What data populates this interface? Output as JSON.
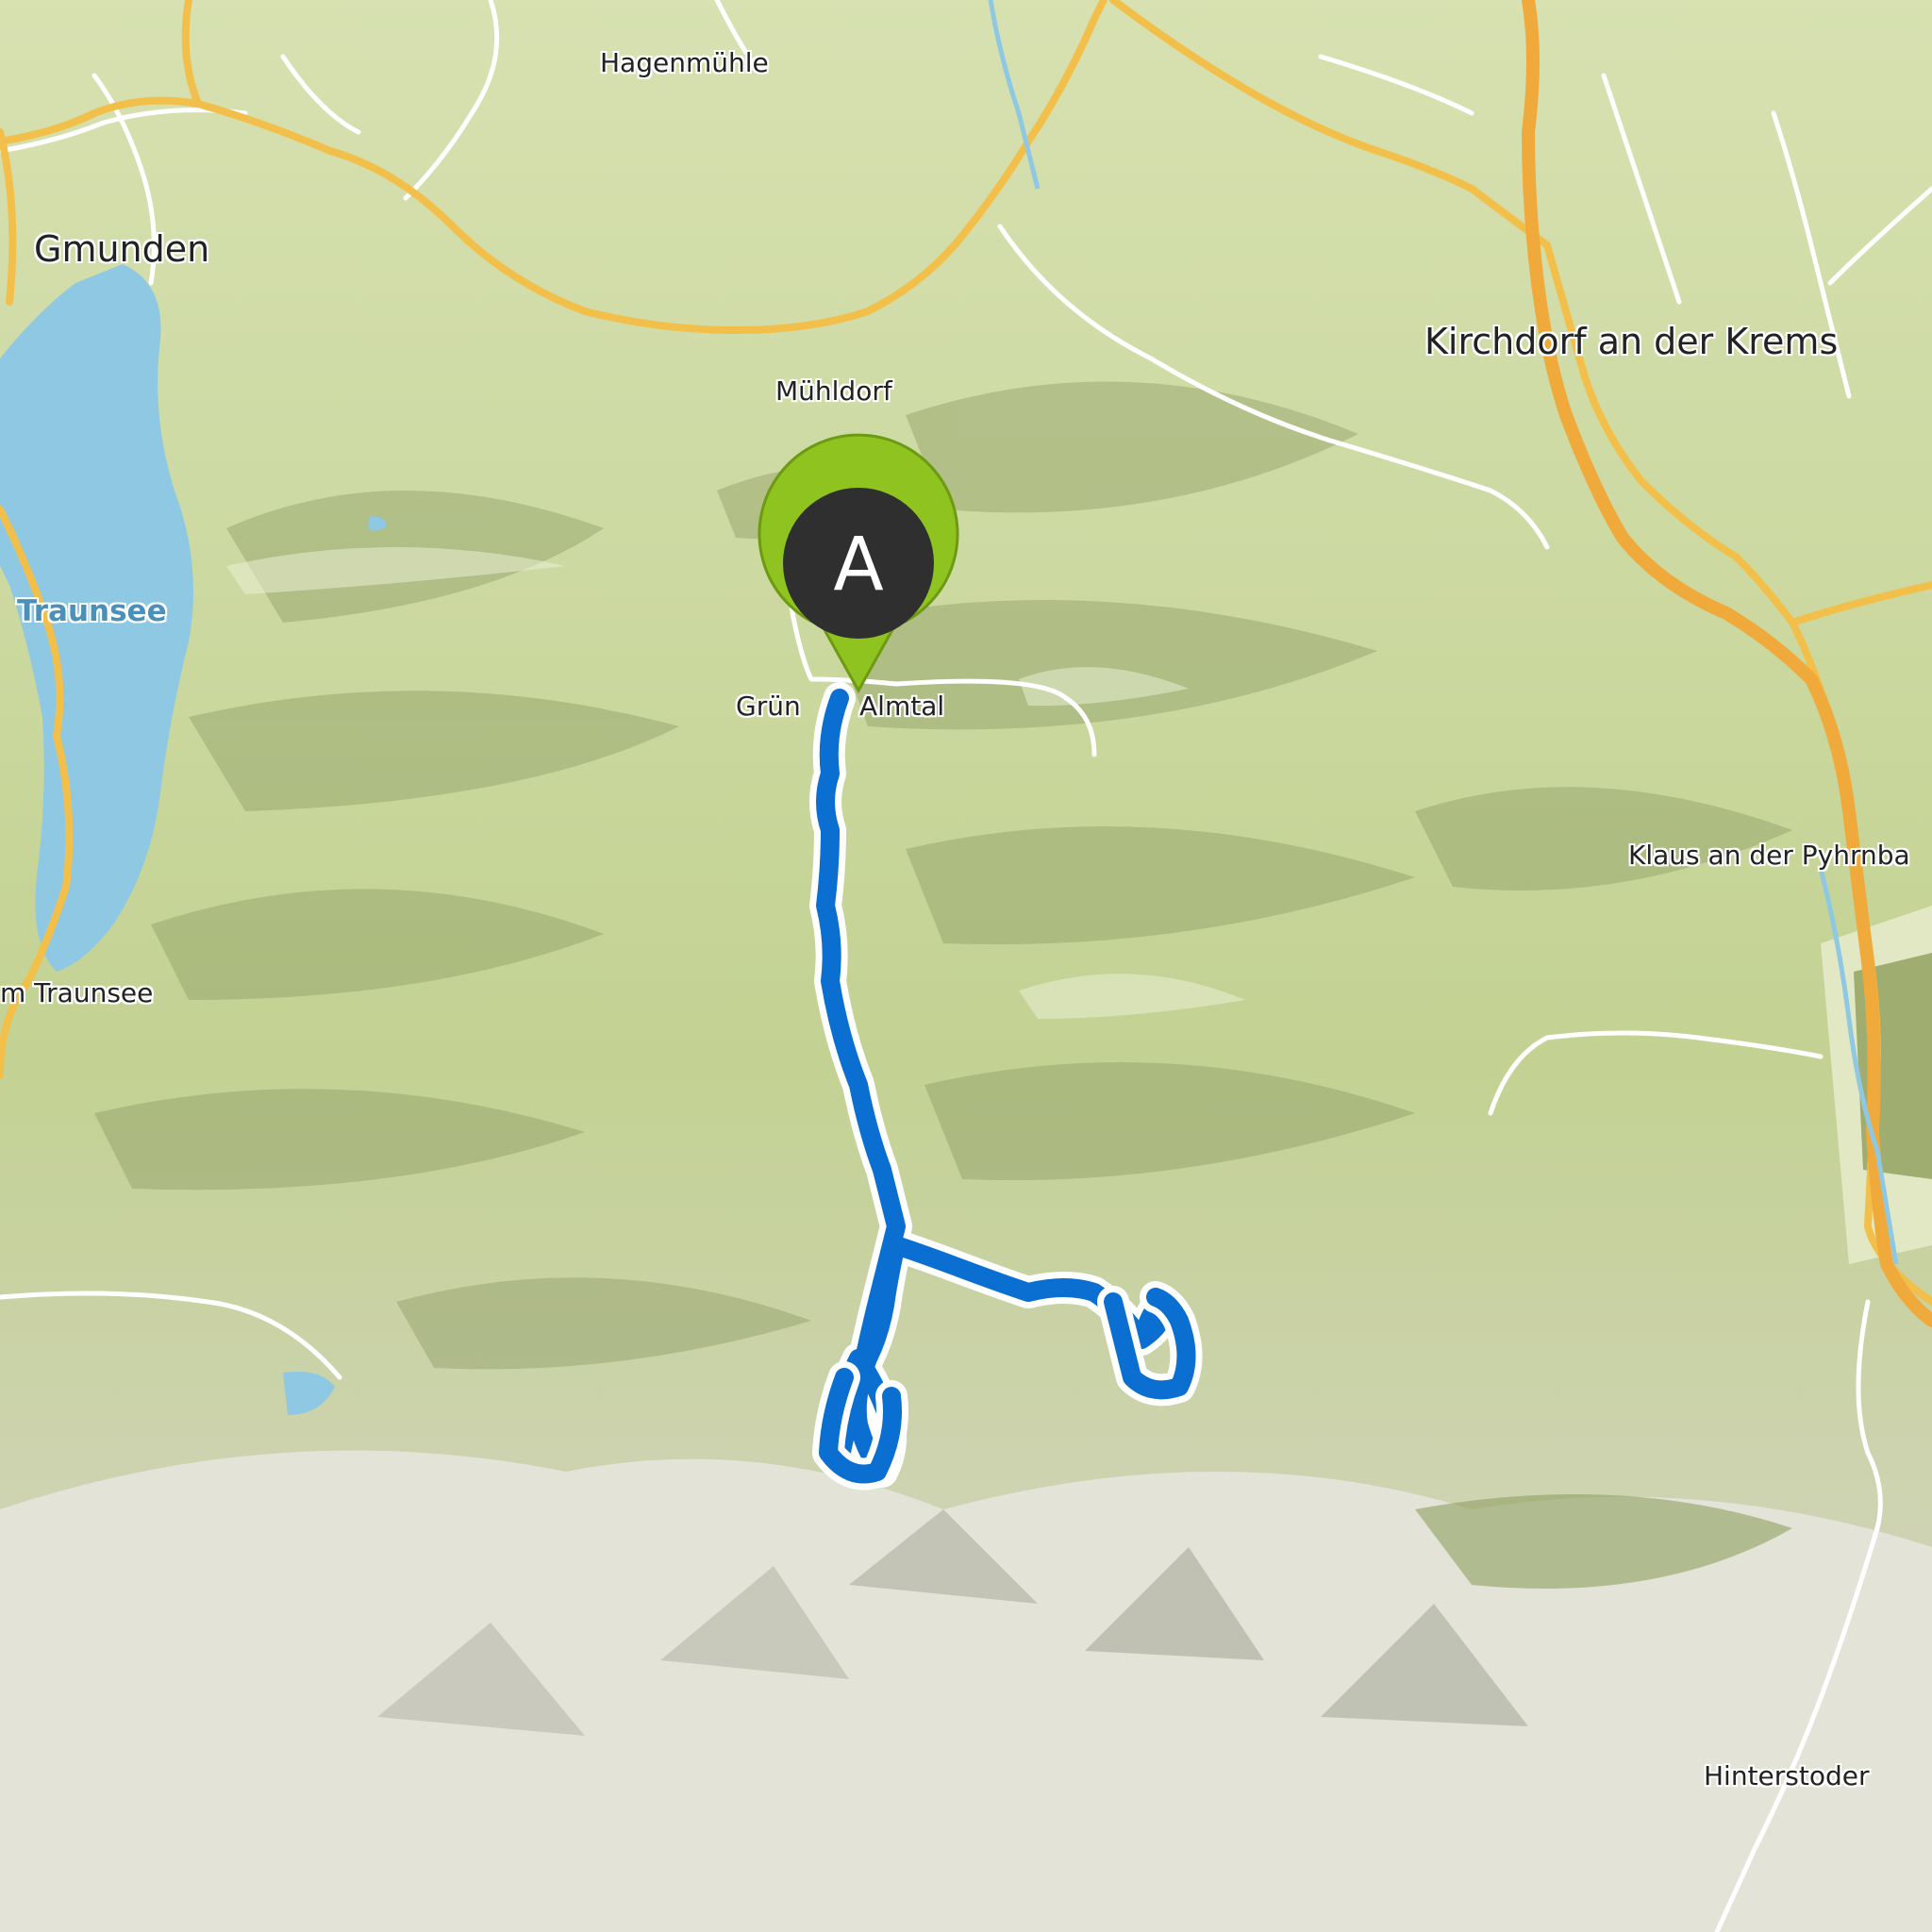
{
  "map": {
    "places": {
      "gmunden": "Gmunden",
      "hagenmuehle": "Hagenmühle",
      "muehldorf": "Mühldorf",
      "kirchdorf": "Kirchdorf an der Krems",
      "gruenau": "Grün       Almtal",
      "klaus": "Klaus an der Pyhrnba",
      "traunsee_town": "m Traunsee",
      "hinterstoder": "Hinterstoder"
    },
    "water": {
      "traunsee": "Traunsee"
    },
    "marker": {
      "letter": "A",
      "color": "#8fc31f"
    },
    "colors": {
      "route": "#0a6fd0",
      "major_road": "#f2c04a",
      "lake": "#8ec8e3",
      "terrain": "#c9d79a"
    }
  }
}
